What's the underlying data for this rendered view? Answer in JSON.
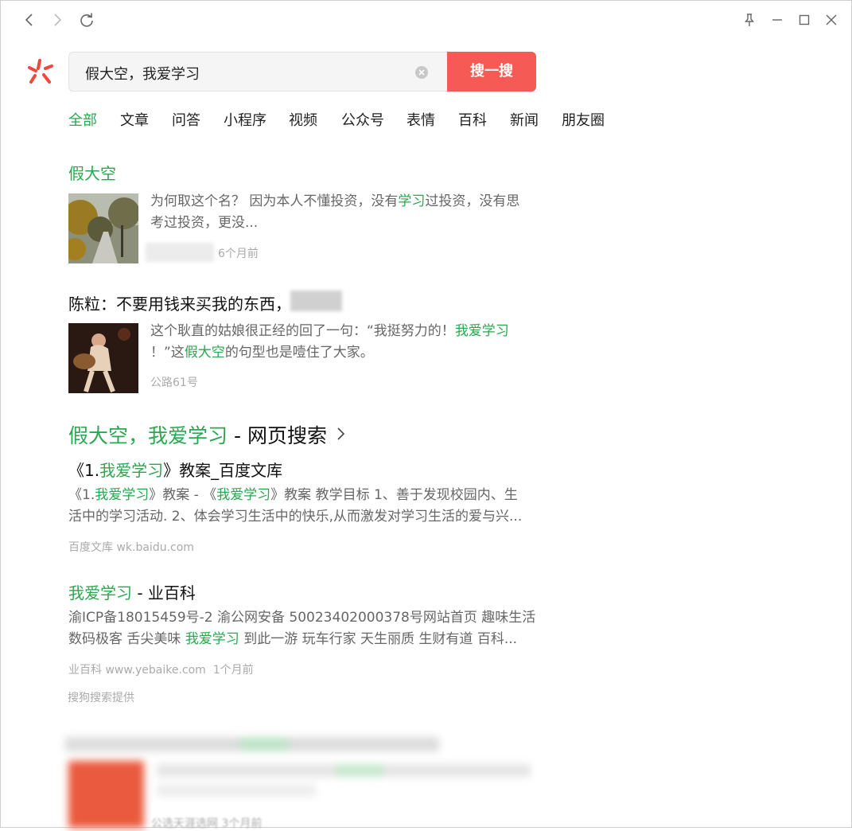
{
  "search": {
    "query": "假大空，我爱学习",
    "button_label": "搜一搜"
  },
  "tabs": [
    {
      "label": "全部",
      "active": true
    },
    {
      "label": "文章"
    },
    {
      "label": "问答"
    },
    {
      "label": "小程序"
    },
    {
      "label": "视频"
    },
    {
      "label": "公众号"
    },
    {
      "label": "表情"
    },
    {
      "label": "百科"
    },
    {
      "label": "新闻"
    },
    {
      "label": "朋友圈"
    }
  ],
  "articles": [
    {
      "title": "假大空",
      "snippet_line1_a": "为何取这个名？ 因为本人不懂投资，没有",
      "snippet_line1_hl": "学习",
      "snippet_line1_b": "过投资，没有思",
      "snippet_line2": "考过投资，更没...",
      "time": "6个月前"
    },
    {
      "title": "陈粒：不要用钱来买我的东西，",
      "snippet_line1_a": "这个耿直的姑娘很正经的回了一句：“我挺努力的！",
      "snippet_line1_hl": "我爱学习",
      "snippet_line2_a": "！”这",
      "snippet_line2_hl": "假大空",
      "snippet_line2_b": "的句型也是噎住了大家。",
      "source": "公路61号"
    }
  ],
  "web_section": {
    "query": "假大空，我爱学习",
    "separator": " - ",
    "label": "网页搜索"
  },
  "web_results": [
    {
      "title_a": "《1.",
      "title_hl": "我爱学习",
      "title_b": "》教案_百度文库",
      "line1_a": "《1.",
      "line1_hl1": "我爱学习",
      "line1_b": "》教案 - 《",
      "line1_hl2": "我爱学习",
      "line1_c": "》教案 教学目标 1、善于发现校园内、生",
      "line2": "活中的学习活动. 2、体会学习生活中的快乐,从而激发对学习生活的爱与兴...",
      "source": "百度文库 wk.baidu.com"
    },
    {
      "title_hl": "我爱学习",
      "title_b": " - 业百科",
      "line1": "渝ICP备18015459号-2 渝公网安备 50023402000378号网站首页 趣味生活",
      "line2_a": "数码极客 舌尖美味 ",
      "line2_hl": "我爱学习",
      "line2_b": " 到此一游 玩车行家 天生丽质 生财有道 百科...",
      "source": "业百科 www.yebaike.com",
      "time": "1个月前"
    }
  ],
  "footer_note": "搜狗搜索提供",
  "blurred_bottom": {
    "meta": "公选天涯选网 3个月前"
  },
  "colors": {
    "accent_green": "#2aa750",
    "button_red": "#f55a55"
  },
  "icons": [
    "back-icon",
    "forward-icon",
    "refresh-icon",
    "pin-icon",
    "minimize-icon",
    "maximize-icon",
    "close-icon",
    "clear-icon",
    "chevron-right-icon",
    "logo-icon"
  ]
}
